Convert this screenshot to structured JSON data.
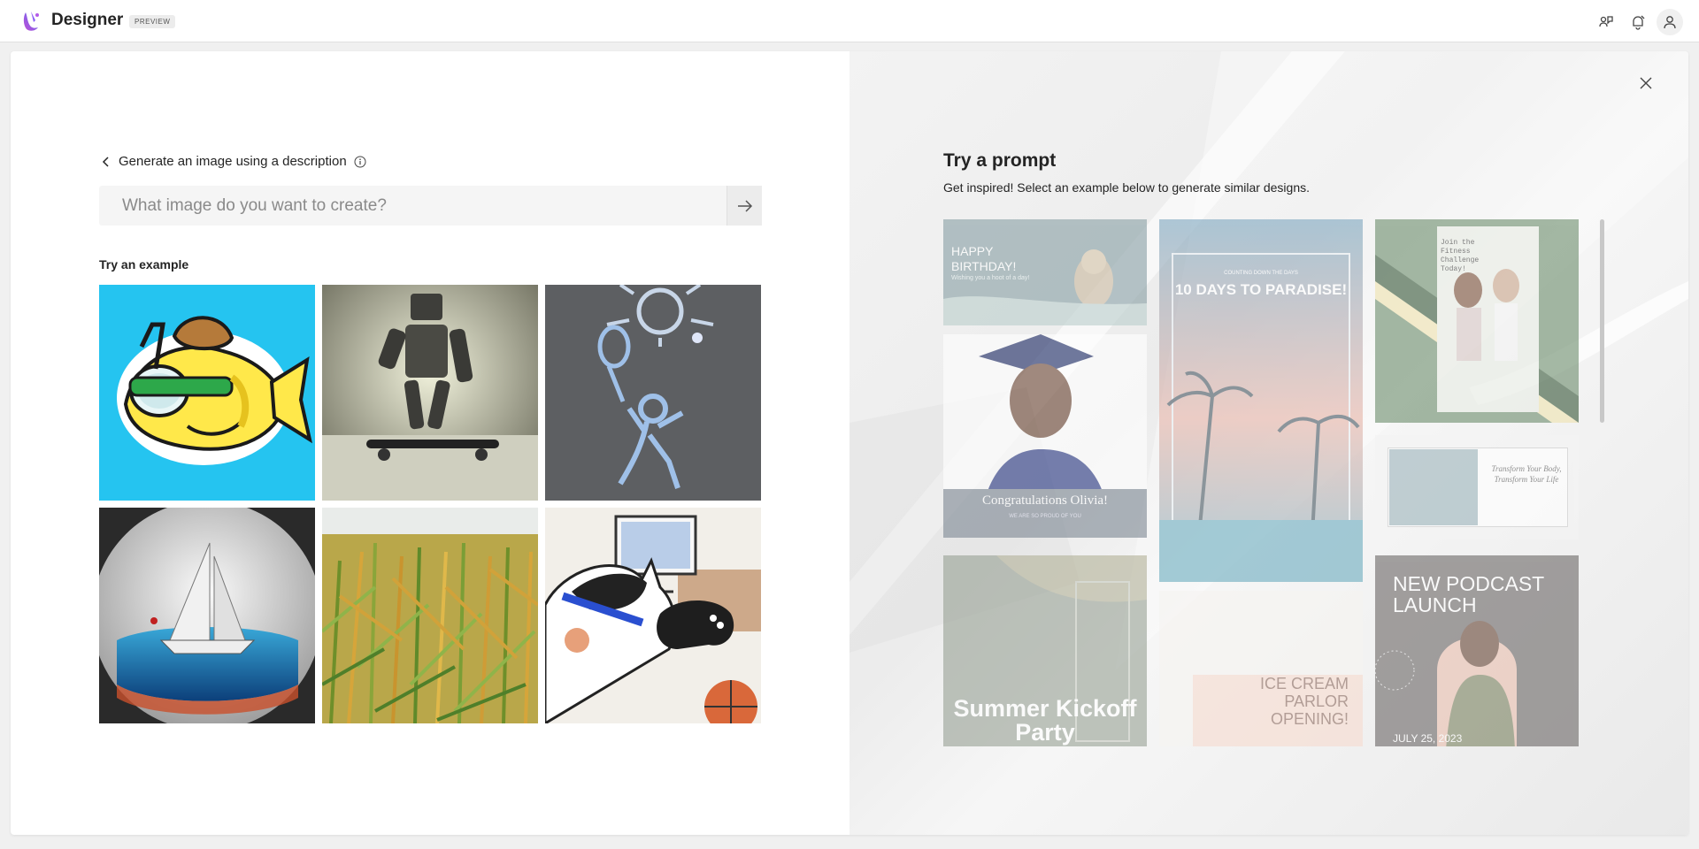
{
  "app": {
    "title": "Designer",
    "badge": "PREVIEW"
  },
  "topbar_icons": [
    "share-icon",
    "notification-icon",
    "account-icon"
  ],
  "left_panel": {
    "back_label": "Generate an image using a description",
    "prompt_placeholder": "What image do you want to create?",
    "try_example_label": "Try an example",
    "examples": [
      "fish-snorkel-sticker",
      "robot-skateboard-photo",
      "chalk-drawing-tennis",
      "ship-in-glass-globe",
      "cornfield-painting",
      "cat-gaming-illustration"
    ]
  },
  "right_panel": {
    "title": "Try a prompt",
    "subtitle": "Get inspired! Select an example below to generate similar designs.",
    "templates": {
      "birthday": {
        "heading": "HAPPY BIRTHDAY!",
        "sub": "Wishing you a hoot of a day!"
      },
      "paradise": {
        "small": "COUNTING DOWN THE DAYS",
        "heading": "10 DAYS TO PARADISE!"
      },
      "fitness": {
        "heading": "Join the Fitness Challenge Today!"
      },
      "graduation": {
        "heading": "Congratulations Olivia!",
        "sub": "WE ARE SO PROUD OF YOU"
      },
      "transform": {
        "heading": "Transform Your Body, Transform Your Life"
      },
      "summer": {
        "heading": "Summer Kickoff Party"
      },
      "icecream": {
        "heading": "ICE CREAM PARLOR OPENING!"
      },
      "podcast": {
        "heading": "NEW PODCAST LAUNCH",
        "date": "JULY 25, 2023"
      }
    }
  },
  "colors": {
    "accent": "#7b4ff0",
    "sticker_bg": "#25c4f0"
  }
}
